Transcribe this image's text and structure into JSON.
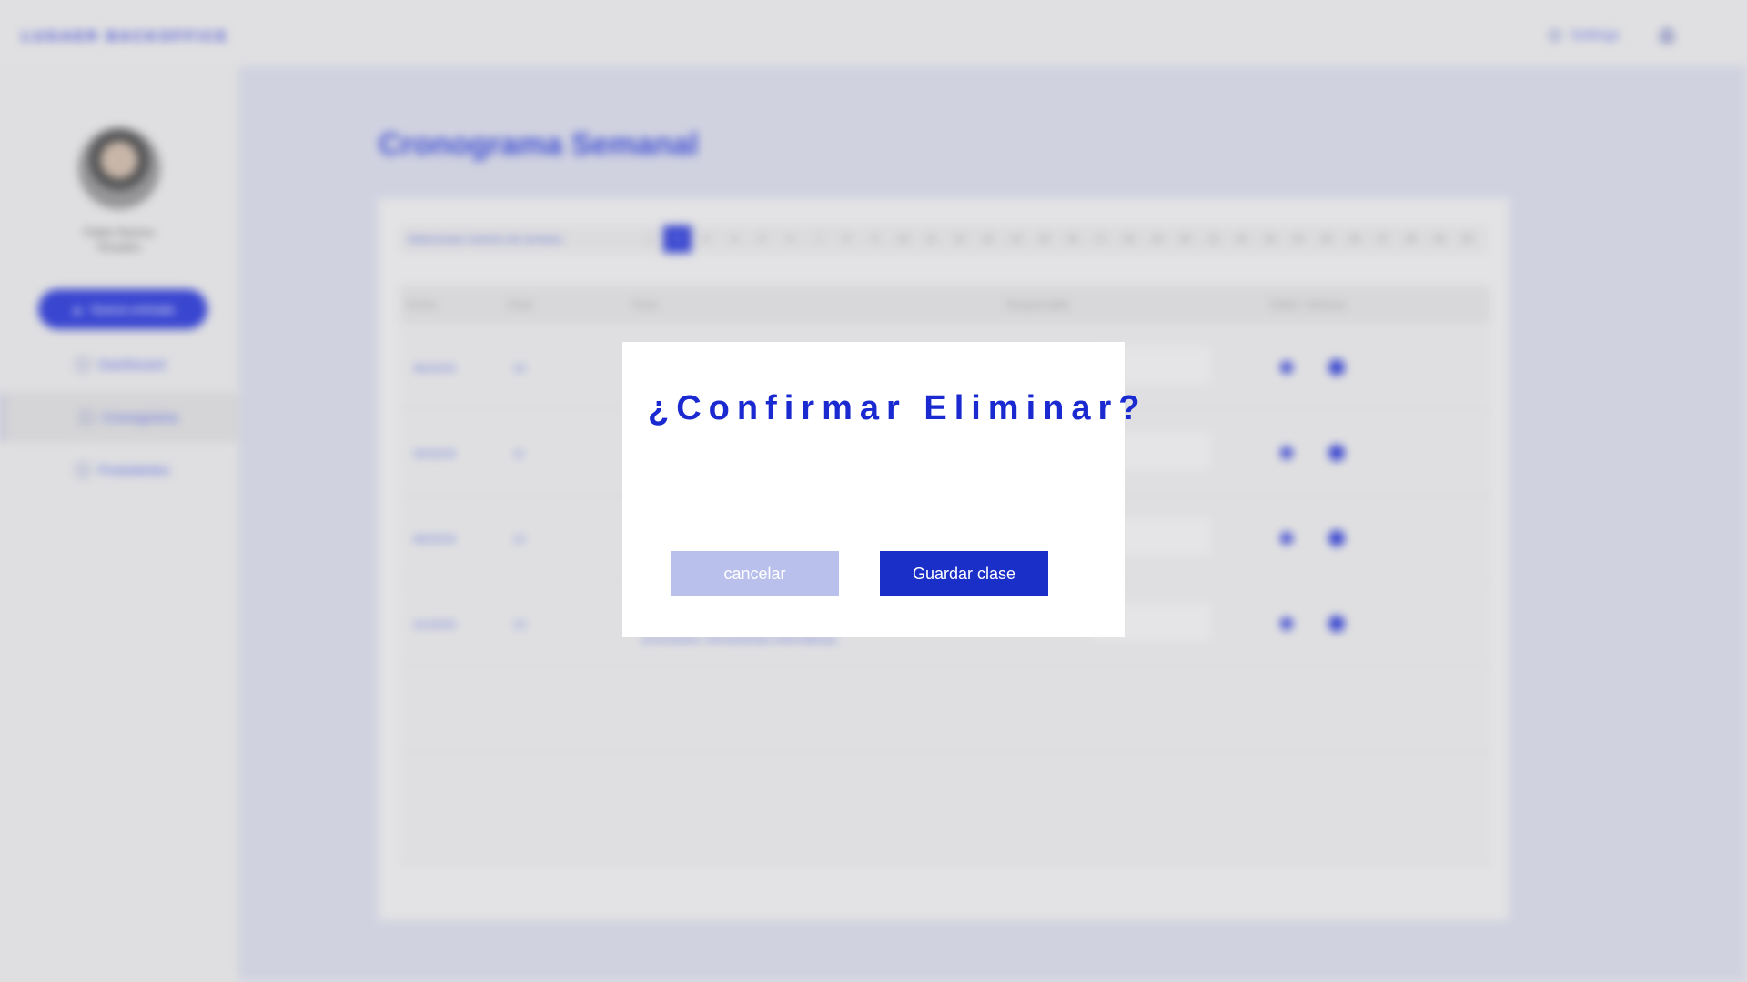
{
  "brand": "LUGAER BACKOFFICE",
  "header": {
    "settings_label": "Settings"
  },
  "user": {
    "name_line1": "Pablo Ramos",
    "name_line2": "Rosales"
  },
  "sidebar": {
    "new_button": "Nueva entrada",
    "items": [
      {
        "label": "Dashboard"
      },
      {
        "label": "Cronograma"
      },
      {
        "label": "Postulantes"
      }
    ]
  },
  "page": {
    "title": "Cronograma Semanal"
  },
  "week_selector": {
    "label": "Seleccionar número de semana",
    "weeks": [
      "1",
      "2",
      "3",
      "4",
      "5",
      "6",
      "7",
      "8",
      "9",
      "10",
      "11",
      "12",
      "13",
      "14",
      "15",
      "16",
      "17",
      "18",
      "19",
      "20",
      "21",
      "22",
      "23",
      "24",
      "25",
      "26",
      "27",
      "28",
      "29",
      "30"
    ],
    "selected": "2"
  },
  "table": {
    "headers": [
      "Fecha",
      "Clase",
      "Tema",
      "Responsable",
      "Editar / eliminar"
    ],
    "rows": [
      {
        "fecha": "06/10/19",
        "clase": "10"
      },
      {
        "fecha": "20/10/19",
        "clase": "11"
      },
      {
        "fecha": "06/10/19",
        "clase": "12"
      },
      {
        "fecha": "21/10/19",
        "clase": "13",
        "tema": "[Conclusión: Herramientas informáticas]"
      }
    ]
  },
  "modal": {
    "title": "¿Confirmar Eliminar?",
    "cancel_label": "cancelar",
    "save_label": "Guardar clase"
  },
  "colors": {
    "accent": "#1a2ad0",
    "cancel": "#b9c0ec",
    "modal_bg": "#ffffff"
  }
}
